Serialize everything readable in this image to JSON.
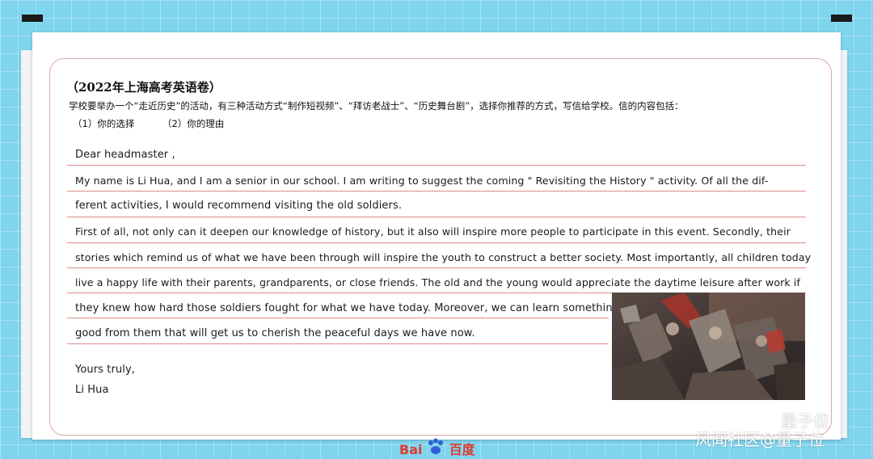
{
  "title": "（2022年上海高考英语卷）",
  "prompt": "学校要举办一个“走近历史”的活动，有三种活动方式“制作短视频”、“拜访老战士”、“历史舞台剧”，选择你推荐的方式，写信给学校。信的内容包括：",
  "options": [
    "（1）你的选择",
    "（2）你的理由"
  ],
  "letter": {
    "lines": [
      "Dear headmaster ,",
      "My name is Li Hua, and I am a senior in our school. I am writing to suggest the coming  \" Revisiting the History \"  activity. Of all the dif-",
      "ferent activities, I would recommend visiting the old soldiers.",
      "First of all, not only can it deepen our knowledge of history, but it also will inspire more people to participate in this event. Secondly, their",
      "stories which remind us of what we have been through will inspire the youth to construct a better society. Most importantly, all children today",
      "live a happy life with their parents, grandparents, or close friends. The old and the young would appreciate the daytime leisure after work if",
      "they knew how hard those soldiers fought for what we have today. Moreover, we can learn something",
      "good from them that will get us to cherish the peaceful days we have now."
    ],
    "closing": "Yours truly,",
    "signature": "Li Hua"
  },
  "watermark": {
    "top": "量子位",
    "bottom": "风闻社区@量子位"
  },
  "logo_text": "Bai",
  "logo_text_cn": "百度",
  "colors": {
    "background": "#7fd4ee",
    "ruled_line": "#e08a8a",
    "card_border": "#d9a9a9",
    "logo": "#e03a2f"
  },
  "icons": [
    "wechat-icon",
    "baidu-paw-icon"
  ]
}
